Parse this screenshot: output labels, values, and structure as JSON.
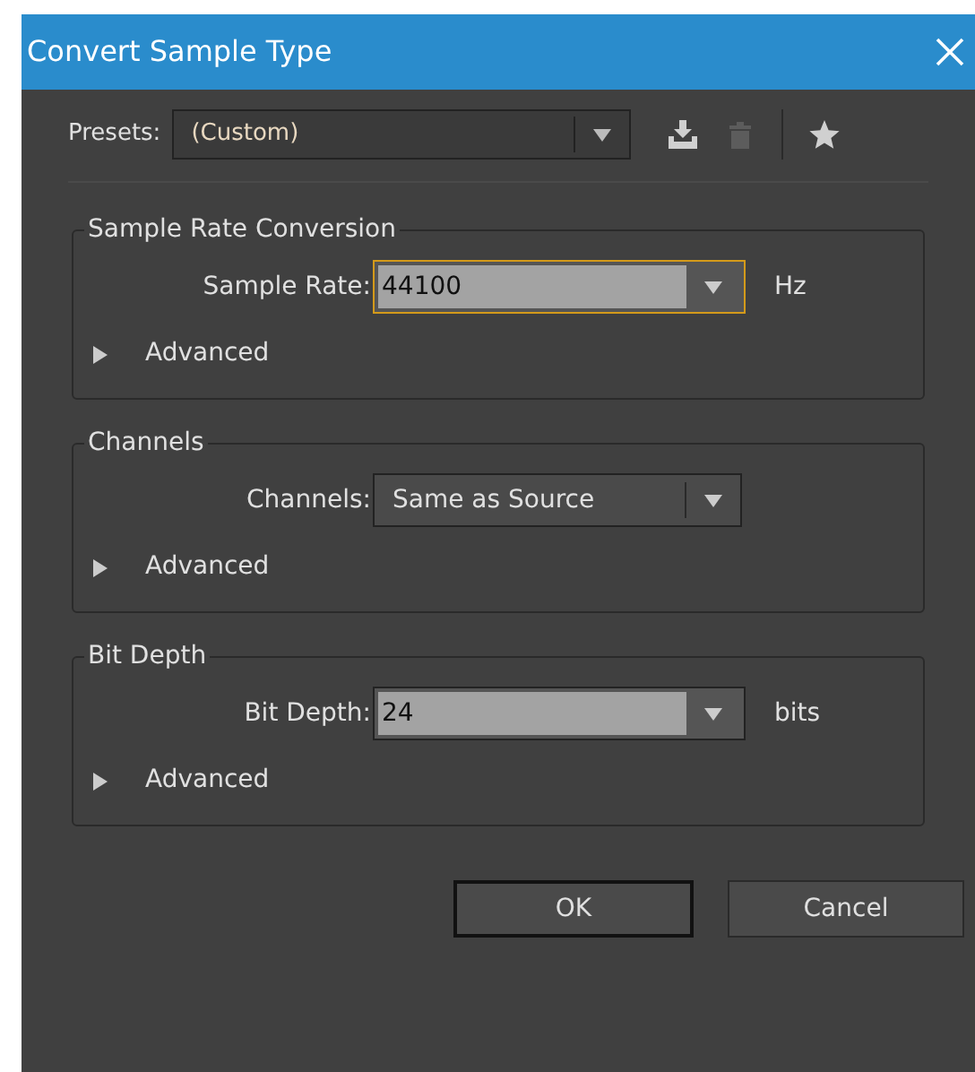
{
  "window": {
    "title": "Convert Sample Type"
  },
  "presets": {
    "label": "Presets:",
    "value": "(Custom)"
  },
  "toolbar": [
    {
      "kind": "save",
      "disabled": false
    },
    {
      "kind": "delete",
      "disabled": true
    },
    {
      "kind": "favorite",
      "disabled": false
    }
  ],
  "sections": [
    {
      "title": "Sample Rate Conversion",
      "field": {
        "label": "Sample Rate:",
        "value": "44100",
        "kind": "combo",
        "focused": true,
        "unit": "Hz"
      },
      "advanced": {
        "label": "Advanced",
        "expanded": false
      }
    },
    {
      "title": "Channels",
      "field": {
        "label": "Channels:",
        "value": "Same as Source",
        "kind": "dropdown",
        "focused": false
      },
      "advanced": {
        "label": "Advanced",
        "expanded": false
      }
    },
    {
      "title": "Bit Depth",
      "field": {
        "label": "Bit Depth:",
        "value": "24",
        "kind": "combo",
        "focused": false,
        "unit": "bits"
      },
      "advanced": {
        "label": "Advanced",
        "expanded": false
      }
    }
  ],
  "buttons": [
    {
      "label": "OK",
      "default": true
    },
    {
      "label": "Cancel",
      "default": false
    }
  ]
}
